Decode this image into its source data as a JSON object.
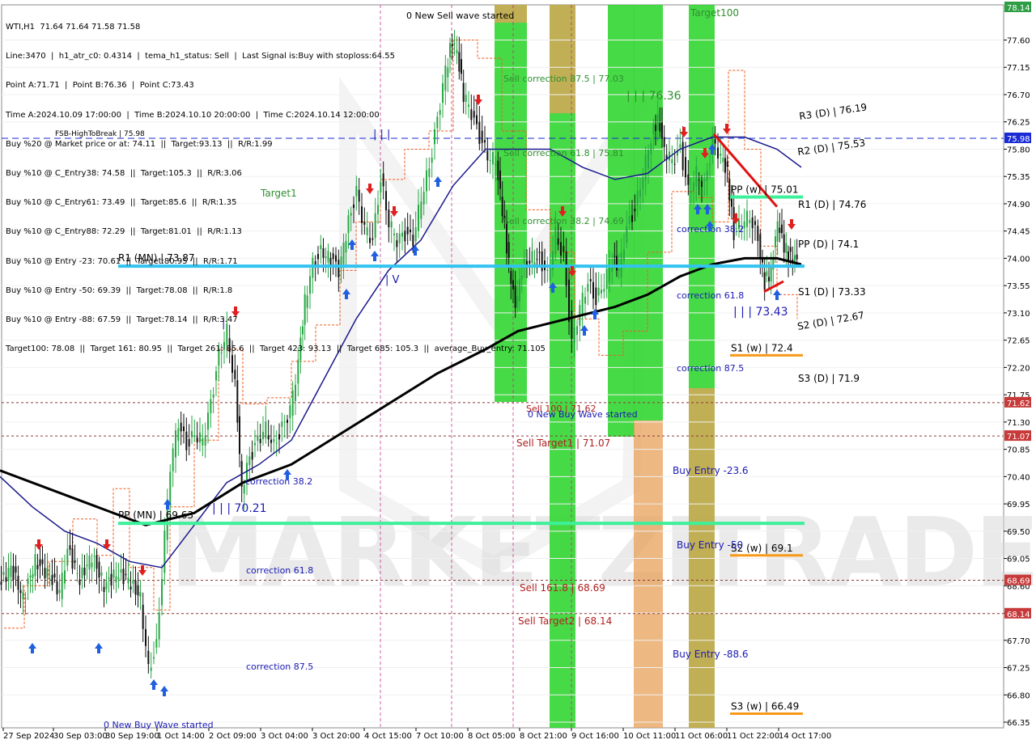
{
  "header": {
    "lines": [
      "WTI,H1  71.64 71.64 71.58 71.58",
      "Line:3470  |  h1_atr_c0: 0.4314  |  tema_h1_status: Sell  |  Last Signal is:Buy with stoploss:64.55",
      "Point A:71.71  |  Point B:76.36  |  Point C:73.43",
      "Time A:2024.10.09 17:00:00  |  Time B:2024.10.10 20:00:00  |  Time C:2024.10.14 12:00:00",
      "Buy %20 @ Market price or at: 74.11  ||  Target:93.13  ||  R/R:1.99",
      "Buy %10 @ C_Entry38: 74.58  ||  Target:105.3  ||  R/R:3.06",
      "Buy %10 @ C_Entry61: 73.49  ||  Target:85.6  ||  R/R:1.35",
      "Buy %10 @ C_Entry88: 72.29  ||  Target:81.01  ||  R/R:1.13",
      "Buy %10 @ Entry -23: 70.61  ||  Target:80.95  ||  R/R:1.71",
      "Buy %10 @ Entry -50: 69.39  ||  Target:78.08  ||  R/R:1.8",
      "Buy %10 @ Entry -88: 67.59  ||  Target:78.14  ||  R/R:3.47",
      "Target100: 78.08  ||  Target 161: 80.95  ||  Target 261: 85.6  ||  Target 423: 93.13  ||  Target 685: 105.3  ||  average_Buy_entry: 71.105"
    ]
  },
  "watermark": {
    "text": "MARKETZITRADE"
  },
  "colors": {
    "ema_blue": "#1a1a8c",
    "ema_black": "#000000",
    "cyan": "#33c3f0",
    "mint": "#3df09a",
    "orange": "#f79a1a",
    "green_band": "#33d633",
    "orange_band": "#e8a05a",
    "buy_arrow": "#1f5fe0",
    "sell_arrow": "#e02020",
    "label_blue": "#1a1ab4",
    "label_red": "#b02020",
    "label_green": "#2f8f2f",
    "candle_up": "#28a745",
    "candle_down": "#111111"
  },
  "chart_data": {
    "type": "line",
    "symbol": "WTI",
    "timeframe": "H1",
    "ylim": [
      66.35,
      78.14
    ],
    "yticks": [
      "77.60",
      "77.15",
      "76.70",
      "76.25",
      "75.80",
      "75.35",
      "74.90",
      "74.45",
      "74.00",
      "73.55",
      "73.10",
      "72.65",
      "72.20",
      "71.75",
      "71.30",
      "70.85",
      "70.40",
      "69.95",
      "69.50",
      "69.05",
      "68.60",
      "68.15",
      "67.70",
      "67.25",
      "66.80",
      "66.35"
    ],
    "xticks": [
      "27 Sep 2024",
      "30 Sep 03:00",
      "30 Sep 19:00",
      "1 Oct 14:00",
      "2 Oct 09:00",
      "3 Oct 04:00",
      "3 Oct 20:00",
      "4 Oct 15:00",
      "7 Oct 10:00",
      "8 Oct 05:00",
      "8 Oct 21:00",
      "9 Oct 16:00",
      "10 Oct 11:00",
      "11 Oct 06:00",
      "11 Oct 22:00",
      "14 Oct 17:00"
    ],
    "price_badges": [
      {
        "value": "78.14",
        "color": "#2e9e44"
      },
      {
        "value": "75.98",
        "color": "#1a2bd6"
      },
      {
        "value": "71.62",
        "color": "#c83a3a"
      },
      {
        "value": "71.07",
        "color": "#c83a3a"
      },
      {
        "value": "68.69",
        "color": "#c83a3a"
      },
      {
        "value": "68.14",
        "color": "#c83a3a"
      }
    ],
    "series": [
      {
        "name": "price_close",
        "points": [
          [
            0,
            68.6
          ],
          [
            15,
            68.9
          ],
          [
            30,
            68.4
          ],
          [
            45,
            69.0
          ],
          [
            60,
            68.8
          ],
          [
            75,
            68.5
          ],
          [
            85,
            69.2
          ],
          [
            100,
            68.7
          ],
          [
            115,
            69.1
          ],
          [
            130,
            68.6
          ],
          [
            145,
            68.8
          ],
          [
            160,
            68.7
          ],
          [
            175,
            68.4
          ],
          [
            185,
            67.2
          ],
          [
            195,
            67.6
          ],
          [
            205,
            69.4
          ],
          [
            212,
            70.6
          ],
          [
            222,
            71.3
          ],
          [
            232,
            70.9
          ],
          [
            242,
            71.1
          ],
          [
            252,
            71.0
          ],
          [
            262,
            71.6
          ],
          [
            272,
            72.4
          ],
          [
            282,
            72.8
          ],
          [
            292,
            71.9
          ],
          [
            300,
            70.2
          ],
          [
            310,
            70.7
          ],
          [
            320,
            71.0
          ],
          [
            330,
            71.2
          ],
          [
            340,
            70.9
          ],
          [
            350,
            71.2
          ],
          [
            360,
            71.5
          ],
          [
            370,
            72.3
          ],
          [
            378,
            73.3
          ],
          [
            388,
            73.9
          ],
          [
            398,
            74.1
          ],
          [
            410,
            74.0
          ],
          [
            420,
            73.8
          ],
          [
            432,
            74.6
          ],
          [
            442,
            75.1
          ],
          [
            452,
            74.5
          ],
          [
            462,
            74.3
          ],
          [
            472,
            75.3
          ],
          [
            482,
            74.6
          ],
          [
            492,
            74.3
          ],
          [
            502,
            74.4
          ],
          [
            512,
            74.3
          ],
          [
            522,
            75.0
          ],
          [
            532,
            75.5
          ],
          [
            542,
            76.3
          ],
          [
            552,
            77.1
          ],
          [
            560,
            77.6
          ],
          [
            566,
            77.4
          ],
          [
            574,
            76.7
          ],
          [
            584,
            76.4
          ],
          [
            594,
            76.0
          ],
          [
            604,
            75.7
          ],
          [
            614,
            75.6
          ],
          [
            622,
            74.8
          ],
          [
            630,
            73.9
          ],
          [
            638,
            73.2
          ],
          [
            646,
            73.8
          ],
          [
            656,
            74.0
          ],
          [
            668,
            74.0
          ],
          [
            678,
            73.7
          ],
          [
            688,
            74.4
          ],
          [
            698,
            74.0
          ],
          [
            708,
            72.6
          ],
          [
            718,
            73.2
          ],
          [
            728,
            73.6
          ],
          [
            738,
            73.3
          ],
          [
            748,
            73.6
          ],
          [
            758,
            74.0
          ],
          [
            766,
            73.8
          ],
          [
            776,
            74.5
          ],
          [
            786,
            74.8
          ],
          [
            796,
            75.4
          ],
          [
            806,
            76.0
          ],
          [
            814,
            76.3
          ],
          [
            822,
            75.8
          ],
          [
            832,
            75.6
          ],
          [
            842,
            75.8
          ],
          [
            852,
            75.1
          ],
          [
            862,
            75.4
          ],
          [
            872,
            75.2
          ],
          [
            882,
            75.9
          ],
          [
            892,
            75.7
          ],
          [
            900,
            75.4
          ],
          [
            908,
            74.4
          ],
          [
            918,
            74.6
          ],
          [
            928,
            74.7
          ],
          [
            938,
            74.3
          ],
          [
            946,
            73.6
          ],
          [
            954,
            73.8
          ],
          [
            962,
            74.6
          ],
          [
            970,
            74.2
          ],
          [
            978,
            74.0
          ],
          [
            986,
            74.0
          ]
        ]
      },
      {
        "name": "ema_blue",
        "points": [
          [
            0,
            70.4
          ],
          [
            40,
            69.9
          ],
          [
            80,
            69.5
          ],
          [
            120,
            69.3
          ],
          [
            160,
            69.0
          ],
          [
            200,
            68.9
          ],
          [
            240,
            69.6
          ],
          [
            280,
            70.3
          ],
          [
            320,
            70.6
          ],
          [
            360,
            71.0
          ],
          [
            400,
            72.0
          ],
          [
            440,
            73.0
          ],
          [
            480,
            73.8
          ],
          [
            520,
            74.3
          ],
          [
            560,
            75.2
          ],
          [
            600,
            75.8
          ],
          [
            640,
            75.8
          ],
          [
            680,
            75.8
          ],
          [
            720,
            75.5
          ],
          [
            760,
            75.3
          ],
          [
            800,
            75.4
          ],
          [
            840,
            75.8
          ],
          [
            880,
            76.0
          ],
          [
            920,
            76.0
          ],
          [
            960,
            75.8
          ],
          [
            990,
            75.5
          ]
        ]
      },
      {
        "name": "ema_black",
        "points": [
          [
            0,
            70.5
          ],
          [
            60,
            70.2
          ],
          [
            120,
            69.9
          ],
          [
            180,
            69.6
          ],
          [
            240,
            69.8
          ],
          [
            300,
            70.3
          ],
          [
            360,
            70.6
          ],
          [
            420,
            71.1
          ],
          [
            480,
            71.6
          ],
          [
            540,
            72.1
          ],
          [
            600,
            72.5
          ],
          [
            640,
            72.8
          ],
          [
            700,
            73.0
          ],
          [
            760,
            73.2
          ],
          [
            800,
            73.4
          ],
          [
            840,
            73.7
          ],
          [
            880,
            73.9
          ],
          [
            920,
            74.0
          ],
          [
            960,
            74.0
          ],
          [
            990,
            73.9
          ]
        ]
      }
    ],
    "horizontal_levels": [
      {
        "label": "R1 (MN) | 73.87",
        "value": 73.87,
        "color": "#33c3f0"
      },
      {
        "label": "PP (MN) | 69.63",
        "value": 69.63,
        "color": "#3df09a"
      },
      {
        "label": "PP (w) | 75.01",
        "value": 75.01,
        "color": "#3df09a"
      },
      {
        "label": "S1 (w) | 72.4",
        "value": 72.4,
        "color": "#f79a1a"
      },
      {
        "label": "S2 (w) | 69.1",
        "value": 69.1,
        "color": "#f79a1a"
      },
      {
        "label": "S3 (w) | 66.49",
        "value": 66.49,
        "color": "#f79a1a"
      },
      {
        "label": "FSB-HighToBreak | 75.98",
        "value": 75.98,
        "color": "#1a2bd6"
      }
    ],
    "daily_pivots": [
      "R3 (D) | 76.19",
      "R2 (D) | 75.53",
      "R1 (D) | 74.76",
      "PP (D) | 74.1",
      "S1 (D) | 73.33",
      "S2 (D) | 72.67",
      "S3 (D) | 71.9"
    ],
    "annotations": [
      "0 New Sell wave started",
      "Target100",
      "Sell correction 87.5 | 77.03",
      "| | | 76.36",
      "Sell correction 61.8 | 75.81",
      "Sell correction 38.2 | 74.69",
      "Target1",
      "correction 38.2",
      "correction 61.8",
      "| | | 73.43",
      "correction 87.5",
      "Sell 100 | 71.62",
      "0 New Buy Wave started",
      "Sell Target1 | 71.07",
      "Buy Entry -23.6",
      "| | | 70.21",
      "correction 38.2",
      "Buy Entry -50",
      "correction 61.8",
      "Sell 161.8 | 68.69",
      "Sell Target2 | 68.14",
      "correction 87.5",
      "Buy Entry -88.6",
      "0 New Buy Wave started",
      "| V",
      "|",
      "| | |"
    ]
  }
}
